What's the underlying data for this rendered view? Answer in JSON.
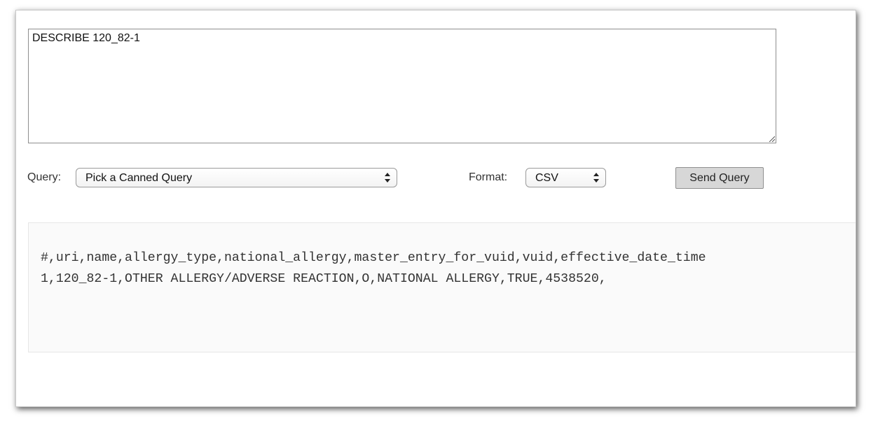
{
  "query_editor": {
    "text": "DESCRIBE 120_82-1"
  },
  "controls": {
    "query_label": "Query:",
    "query_select_value": "Pick a Canned Query",
    "format_label": "Format:",
    "format_select_value": "CSV",
    "send_button_label": "Send Query"
  },
  "result": {
    "lines": [
      "#,uri,name,allergy_type,national_allergy,master_entry_for_vuid,vuid,effective_date_time",
      "1,120_82-1,OTHER ALLERGY/ADVERSE REACTION,O,NATIONAL ALLERGY,TRUE,4538520,"
    ]
  },
  "icons": {
    "resize_grip": "resize-grip-icon",
    "select_arrows": "up-down-chevron-icon"
  }
}
